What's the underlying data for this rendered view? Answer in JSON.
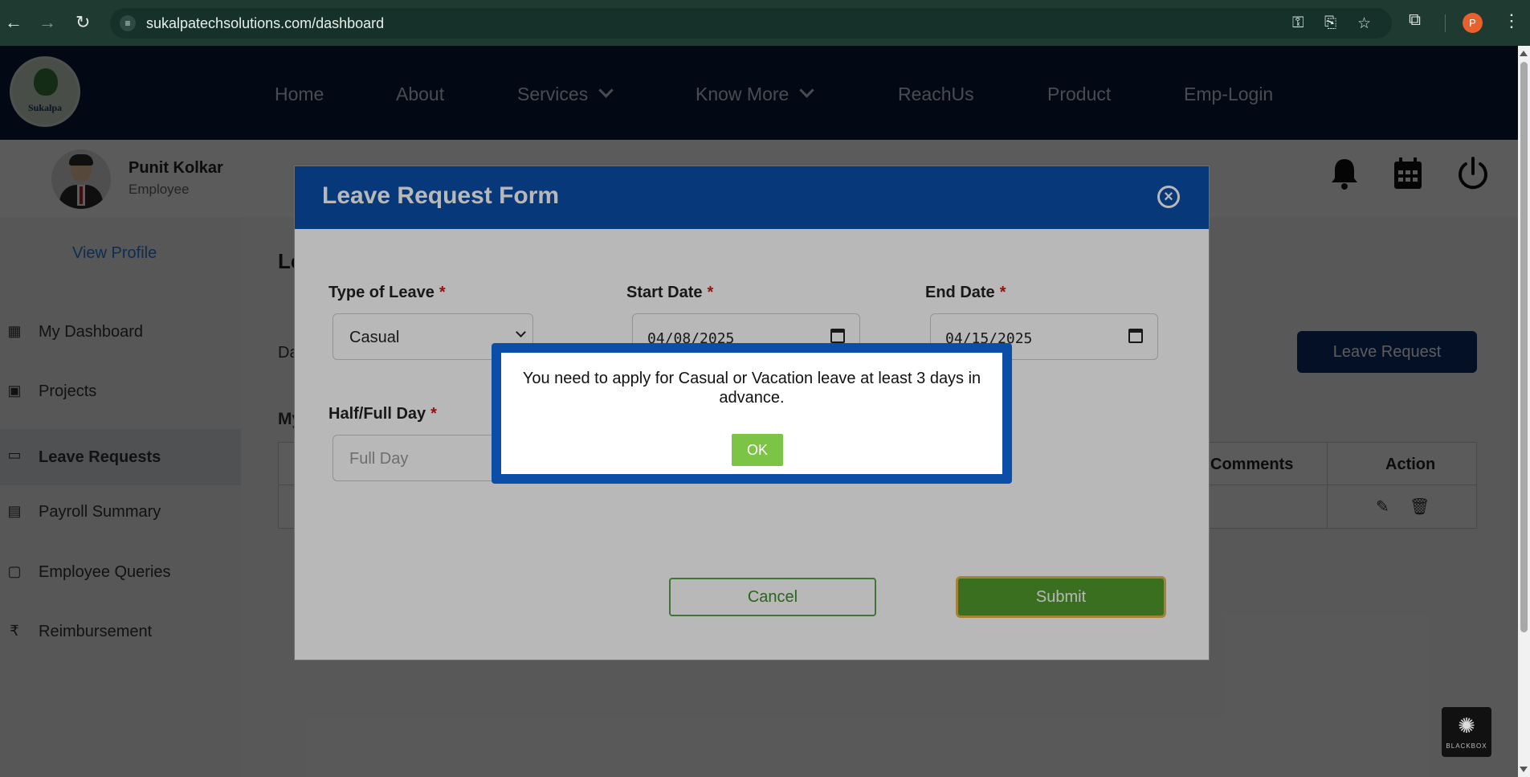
{
  "browser": {
    "url": "sukalpatechsolutions.com/dashboard",
    "profile_initial": "P"
  },
  "site": {
    "logo_text": "Sukalpa",
    "menu": [
      {
        "label": "Home"
      },
      {
        "label": "About"
      },
      {
        "label": "Services"
      },
      {
        "label": "Know More"
      },
      {
        "label": "ReachUs"
      },
      {
        "label": "Product"
      },
      {
        "label": "Emp-Login"
      }
    ]
  },
  "user": {
    "name": "Punit Kolkar",
    "role": "Employee",
    "view_profile": "View Profile"
  },
  "sidebar": {
    "items": [
      {
        "label": "My Dashboard",
        "icon": "dashboard-icon"
      },
      {
        "label": "Projects",
        "icon": "projects-icon"
      },
      {
        "label": "Leave Requests",
        "icon": "leave-icon"
      },
      {
        "label": "Payroll Summary",
        "icon": "payroll-icon"
      },
      {
        "label": "Employee Queries",
        "icon": "queries-icon"
      },
      {
        "label": "Reimbursement",
        "icon": "rupee-icon"
      }
    ],
    "active": "Leave Requests"
  },
  "content": {
    "heading_fragment": "Le",
    "date_fragment": "Da",
    "my_fragment": "My",
    "leave_request_button": "Leave Request",
    "table_headers": {
      "comments": "Comments",
      "action": "Action"
    }
  },
  "modal": {
    "title": "Leave Request Form",
    "fields": {
      "type_of_leave": {
        "label": "Type of Leave",
        "value": "Casual"
      },
      "start_date": {
        "label": "Start Date",
        "value": "04/08/2025"
      },
      "end_date": {
        "label": "End Date",
        "value": "04/15/2025"
      },
      "half_full_day": {
        "label": "Half/Full Day",
        "value": "Full Day"
      }
    },
    "required_mark": "*",
    "cancel_label": "Cancel",
    "submit_label": "Submit"
  },
  "alert": {
    "message": "You need to apply for Casual or Vacation leave at least 3 days in advance.",
    "ok_label": "OK"
  },
  "badge": {
    "text": "BLACKBOX"
  },
  "colors": {
    "header_bg": "#0a1a38",
    "modal_header": "#0a4ea8",
    "submit_green": "#4f9a2a",
    "ok_green": "#7cc445",
    "leave_btn": "#0c2f6b"
  }
}
